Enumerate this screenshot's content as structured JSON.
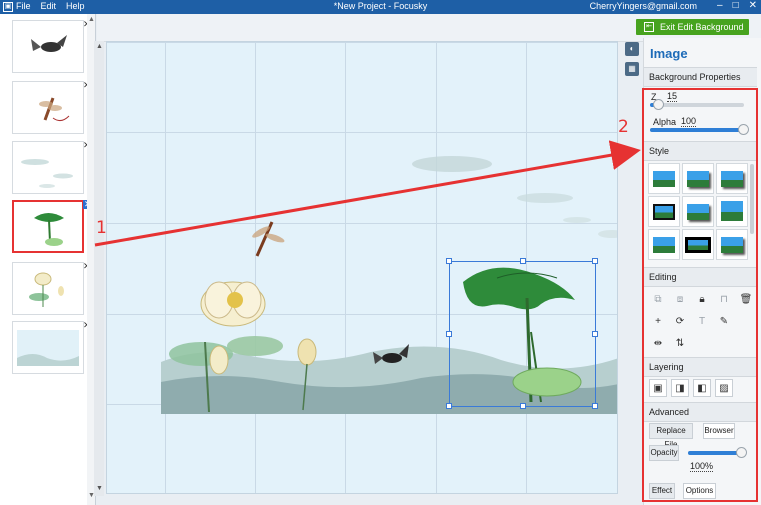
{
  "titlebar": {
    "menu": [
      "File",
      "Edit",
      "Help"
    ],
    "title": "*New Project - Focusky",
    "account": "CherryYingers@gmail.com",
    "minimize": "–",
    "maximize": "□",
    "close": "✕"
  },
  "toolbar": {
    "exit_label": "Exit Edit Background"
  },
  "thumbnails": [
    {
      "icon": "fish-thumbnail-icon"
    },
    {
      "icon": "dragonfly-thumbnail-icon"
    },
    {
      "icon": "mist-thumbnail-icon"
    },
    {
      "icon": "lotus-leaf-thumbnail-icon",
      "selected": true
    },
    {
      "icon": "lotus-flower-thumbnail-icon"
    },
    {
      "icon": "landscape-thumbnail-icon"
    }
  ],
  "panel": {
    "title": "Image",
    "background_properties": "Background Properties",
    "z_label": "Z",
    "z_value": "15",
    "alpha_label": "Alpha",
    "alpha_value": "100",
    "style_label": "Style",
    "editing_label": "Editing",
    "layering_label": "Layering",
    "advanced_label": "Advanced",
    "replace_file": "Replace File",
    "browser": "Browser",
    "opacity_label": "Opacity",
    "opacity_value": "100%",
    "effect": "Effect",
    "options": "Options",
    "z_level": 0.1,
    "alpha_level": 1.0,
    "opacity_level": 1.0
  },
  "annotations": {
    "one": "1",
    "two": "2"
  },
  "colors": {
    "accent": "#1d6bb8",
    "exit_button": "#47a31f",
    "annotation_red": "#e63232",
    "selection": "#3a7ad8"
  }
}
